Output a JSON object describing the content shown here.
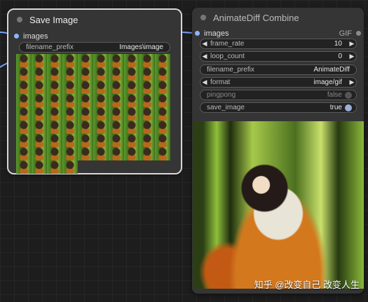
{
  "nodes": {
    "save_image": {
      "title": "Save Image",
      "input_label": "images",
      "widgets": {
        "filename_prefix": {
          "label": "filename_prefix",
          "value": "Images\\image"
        }
      }
    },
    "animatediff_combine": {
      "title": "AnimateDiff Combine",
      "input_label": "images",
      "output_label": "GIF",
      "widgets": {
        "frame_rate": {
          "label": "frame_rate",
          "value": "10"
        },
        "loop_count": {
          "label": "loop_count",
          "value": "0"
        },
        "filename_prefix": {
          "label": "filename_prefix",
          "value": "AnimateDiff"
        },
        "format": {
          "label": "format",
          "value": "image/gif"
        },
        "pingpong": {
          "label": "pingpong",
          "value": "false"
        },
        "save_image": {
          "label": "save_image",
          "value": "true"
        }
      }
    }
  },
  "watermark": "知乎 @改变自己 改变人生",
  "colors": {
    "canvas": "#1d1d1d",
    "node_body": "#353535",
    "input_slot": "#8fb4ff",
    "wire": "#7aa2f7"
  },
  "icons": {
    "arrow_left": "◀",
    "arrow_right": "▶"
  }
}
